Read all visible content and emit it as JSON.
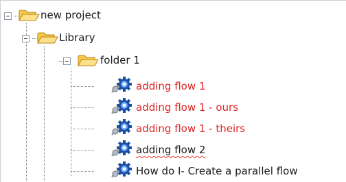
{
  "tree": {
    "root": {
      "label": "new project",
      "expanded": true,
      "icon": "open-folder-icon"
    },
    "library": {
      "label": "Library",
      "expanded": true,
      "icon": "open-folder-icon"
    },
    "folder1": {
      "label": "folder 1",
      "expanded": true,
      "icon": "open-folder-icon"
    },
    "flows": [
      {
        "label": "adding flow 1",
        "color": "#e02424",
        "icon": "flow-gear-icon"
      },
      {
        "label": "adding flow 1 - ours",
        "color": "#e02424",
        "icon": "flow-gear-icon"
      },
      {
        "label": "adding flow 1 - theirs",
        "color": "#e02424",
        "icon": "flow-gear-icon"
      },
      {
        "label": "adding flow 2",
        "color": "#1a1a1a",
        "icon": "flow-gear-icon",
        "spellcheck_underline": true
      },
      {
        "label": "How do I- Create a parallel flow",
        "color": "#1a1a1a",
        "icon": "flow-gear-icon"
      }
    ]
  }
}
